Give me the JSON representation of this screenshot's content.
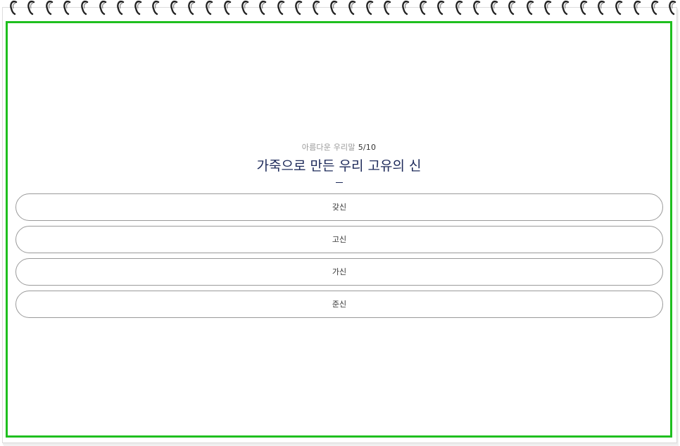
{
  "quiz": {
    "category": "아름다운 우리말",
    "progress": "5/10",
    "question": "가죽으로 만든 우리 고유의 신",
    "options": [
      "갖신",
      "고신",
      "가신",
      "준신"
    ]
  },
  "colors": {
    "frame_border": "#1fbf1f",
    "question_text": "#1d2a5a",
    "option_border": "#9a9a9a"
  },
  "icons": {
    "binding": "spiral-ring-icon"
  }
}
